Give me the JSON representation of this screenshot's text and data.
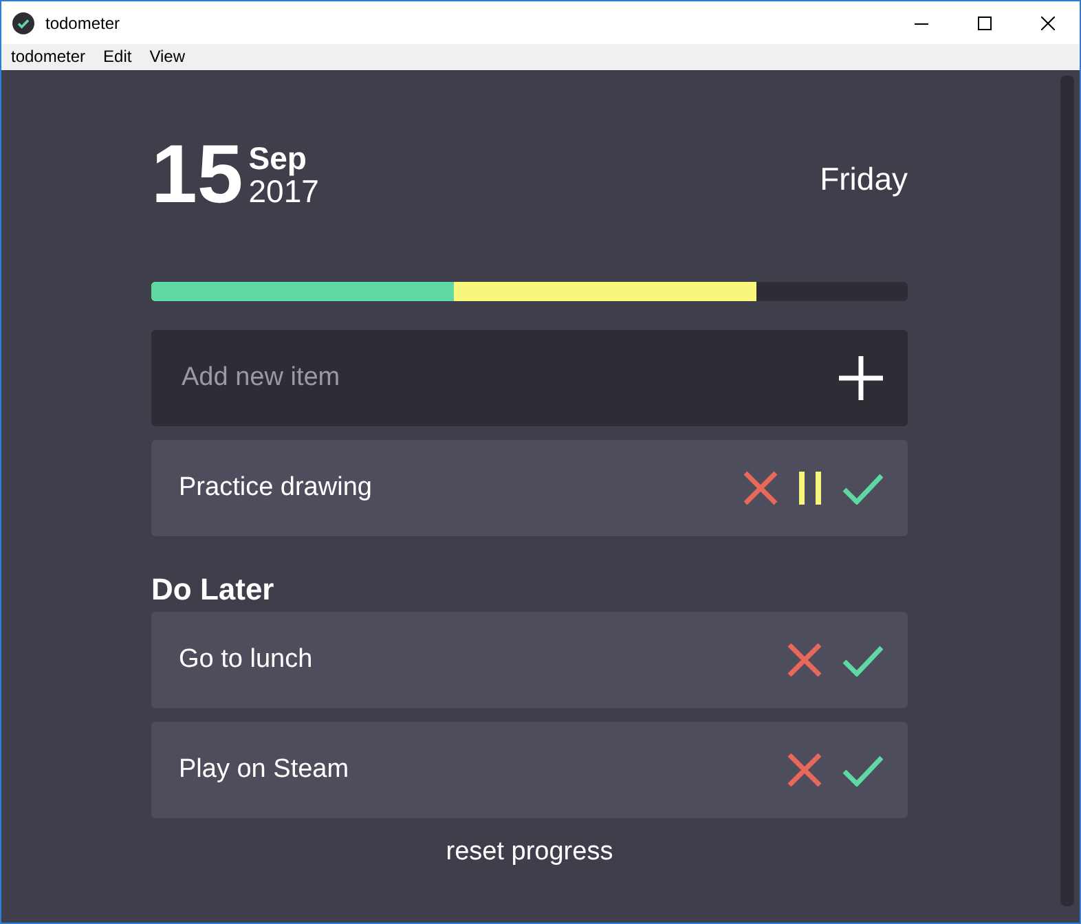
{
  "window": {
    "title": "todometer"
  },
  "menu": [
    "todometer",
    "Edit",
    "View"
  ],
  "date": {
    "day": "15",
    "month": "Sep",
    "year": "2017",
    "weekday": "Friday"
  },
  "progress": [
    {
      "color": "#5fd8a4",
      "level": 0.4
    },
    {
      "color": "#f8f67c",
      "level": 0.8
    }
  ],
  "add_item": {
    "placeholder": "Add new item"
  },
  "items": [
    {
      "text": "Practice drawing",
      "kind": "current"
    }
  ],
  "later": {
    "heading": "Do Later",
    "items": [
      {
        "text": "Go to lunch",
        "kind": "later"
      },
      {
        "text": "Play on Steam",
        "kind": "later"
      }
    ]
  },
  "reset": "reset progress"
}
